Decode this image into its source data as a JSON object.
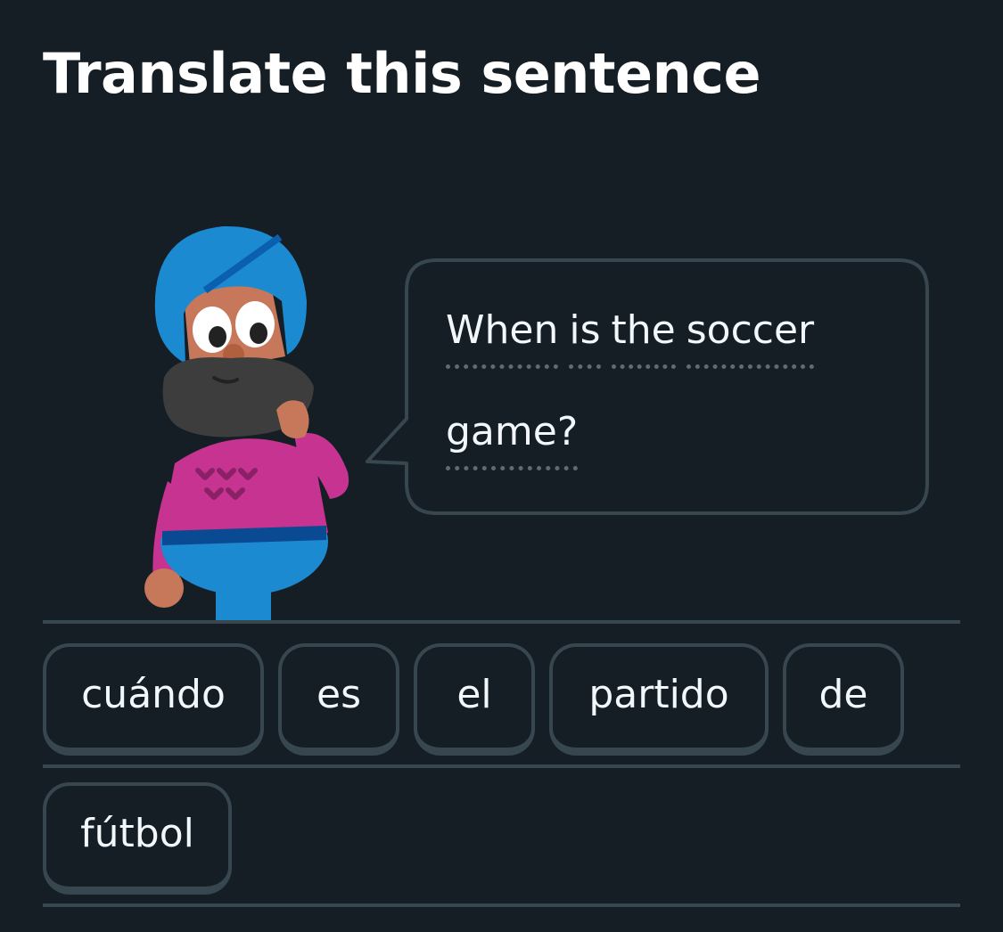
{
  "header": {
    "title": "Translate this sentence"
  },
  "character": {
    "icon": "turbaned-character-illustration"
  },
  "speech_bubble": {
    "lines": [
      [
        "When",
        "is",
        "the",
        "soccer"
      ],
      [
        "game?"
      ]
    ]
  },
  "word_bank": {
    "rows": [
      [
        "cuándo",
        "es",
        "el",
        "partido",
        "de"
      ],
      [
        "fútbol"
      ]
    ]
  },
  "colors": {
    "background": "#151E25",
    "border": "#37464F",
    "text": "#F1F7FB",
    "turban": "#1C8AD0",
    "sweater": "#C63390",
    "beard": "#3D3D3D",
    "skin": "#C8785A"
  }
}
